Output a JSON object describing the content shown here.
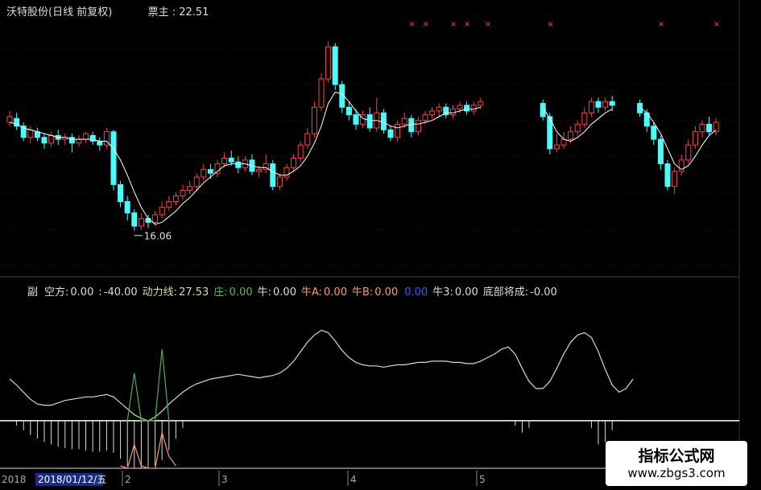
{
  "main_header": {
    "title": "沃特股份(日线 前复权)",
    "indicator_label": "票主",
    "indicator_value": "22.51"
  },
  "sub_header": {
    "items": [
      {
        "label": "副",
        "value": "",
        "color": "#dddddd"
      },
      {
        "label": "空方:",
        "value": "0.00",
        "color": "#dddddd"
      },
      {
        "label": ":",
        "value": "-40.00",
        "color": "#dddddd"
      },
      {
        "label": "动力线:",
        "value": "27.53",
        "color": "#dddd99"
      },
      {
        "label": "庄:",
        "value": "0.00",
        "color": "#55bb55"
      },
      {
        "label": "牛:",
        "value": "0.00",
        "color": "#dddddd"
      },
      {
        "label": "牛A:",
        "value": "0.00",
        "color": "#ff9966"
      },
      {
        "label": "牛B:",
        "value": "0.00",
        "color": "#ff9966"
      },
      {
        "label": "",
        "value": "0.00",
        "color": "#4455ff"
      },
      {
        "label": "牛3:",
        "value": "0.00",
        "color": "#dddddd"
      },
      {
        "label": "底部将成:",
        "value": "-0.00",
        "color": "#dddddd"
      }
    ]
  },
  "annotations": {
    "low_marker": "16.06"
  },
  "date_axis": {
    "label_left": "2018",
    "cursor_date": "2018/01/12/五",
    "ticks": [
      "2",
      "3",
      "4",
      "5"
    ]
  },
  "watermark": {
    "line1": "指标公式网",
    "line2": "www.zbgs3.com"
  },
  "colors": {
    "up": "#ff4040",
    "down": "#44ffff",
    "ma_line": "#ffffff",
    "power_line": "#dddd99",
    "bull_line": "#4caf50",
    "bear_line": "#ff9955",
    "baseline": "#ffffff",
    "marker_x": "#ff4444"
  },
  "chart_data": [
    {
      "type": "candlestick",
      "title": "沃特股份(日线 前复权)",
      "ylim": [
        14,
        27
      ],
      "candles": [
        {
          "i": 0,
          "o": 21.8,
          "c": 22.1,
          "h": 22.4,
          "l": 21.6
        },
        {
          "i": 1,
          "o": 22.0,
          "c": 21.6,
          "h": 22.3,
          "l": 21.4
        },
        {
          "i": 2,
          "o": 21.6,
          "c": 21.0,
          "h": 21.8,
          "l": 20.8
        },
        {
          "i": 3,
          "o": 21.0,
          "c": 21.4,
          "h": 21.6,
          "l": 20.7
        },
        {
          "i": 4,
          "o": 21.3,
          "c": 21.0,
          "h": 21.5,
          "l": 20.8
        },
        {
          "i": 5,
          "o": 21.0,
          "c": 20.7,
          "h": 21.2,
          "l": 20.4
        },
        {
          "i": 6,
          "o": 20.7,
          "c": 21.1,
          "h": 21.3,
          "l": 20.5
        },
        {
          "i": 7,
          "o": 21.1,
          "c": 20.9,
          "h": 21.4,
          "l": 20.6
        },
        {
          "i": 8,
          "o": 20.9,
          "c": 21.0,
          "h": 21.2,
          "l": 20.6
        },
        {
          "i": 9,
          "o": 21.0,
          "c": 20.7,
          "h": 21.2,
          "l": 20.2
        },
        {
          "i": 10,
          "o": 20.7,
          "c": 20.9,
          "h": 21.1,
          "l": 20.5
        },
        {
          "i": 11,
          "o": 20.9,
          "c": 21.2,
          "h": 21.3,
          "l": 20.7
        },
        {
          "i": 12,
          "o": 21.1,
          "c": 20.8,
          "h": 21.3,
          "l": 20.6
        },
        {
          "i": 13,
          "o": 20.8,
          "c": 20.6,
          "h": 21.0,
          "l": 20.3
        },
        {
          "i": 14,
          "o": 20.6,
          "c": 21.3,
          "h": 21.5,
          "l": 20.4
        },
        {
          "i": 15,
          "o": 21.3,
          "c": 18.5,
          "h": 21.4,
          "l": 18.2
        },
        {
          "i": 16,
          "o": 18.5,
          "c": 17.6,
          "h": 18.7,
          "l": 17.3
        },
        {
          "i": 17,
          "o": 17.6,
          "c": 17.0,
          "h": 17.9,
          "l": 16.6
        },
        {
          "i": 18,
          "o": 17.0,
          "c": 16.3,
          "h": 17.2,
          "l": 16.06
        },
        {
          "i": 19,
          "o": 16.3,
          "c": 16.7,
          "h": 17.0,
          "l": 16.1
        },
        {
          "i": 20,
          "o": 16.7,
          "c": 16.5,
          "h": 16.9,
          "l": 16.2
        },
        {
          "i": 21,
          "o": 16.5,
          "c": 16.9,
          "h": 17.1,
          "l": 16.3
        },
        {
          "i": 22,
          "o": 16.9,
          "c": 17.3,
          "h": 17.6,
          "l": 16.7
        },
        {
          "i": 23,
          "o": 17.3,
          "c": 17.6,
          "h": 17.9,
          "l": 17.1
        },
        {
          "i": 24,
          "o": 17.6,
          "c": 17.9,
          "h": 18.1,
          "l": 17.4
        },
        {
          "i": 25,
          "o": 17.9,
          "c": 18.2,
          "h": 18.5,
          "l": 17.7
        },
        {
          "i": 26,
          "o": 18.2,
          "c": 18.4,
          "h": 18.7,
          "l": 18.0
        },
        {
          "i": 27,
          "o": 18.4,
          "c": 18.9,
          "h": 19.1,
          "l": 18.2
        },
        {
          "i": 28,
          "o": 18.9,
          "c": 19.3,
          "h": 19.6,
          "l": 18.7
        },
        {
          "i": 29,
          "o": 19.3,
          "c": 19.1,
          "h": 19.6,
          "l": 18.8
        },
        {
          "i": 30,
          "o": 19.1,
          "c": 19.6,
          "h": 19.8,
          "l": 18.9
        },
        {
          "i": 31,
          "o": 19.6,
          "c": 19.9,
          "h": 20.2,
          "l": 19.4
        },
        {
          "i": 32,
          "o": 19.9,
          "c": 19.7,
          "h": 20.3,
          "l": 19.5
        },
        {
          "i": 33,
          "o": 19.7,
          "c": 19.4,
          "h": 20.0,
          "l": 19.1
        },
        {
          "i": 34,
          "o": 19.4,
          "c": 19.8,
          "h": 20.0,
          "l": 19.2
        },
        {
          "i": 35,
          "o": 19.8,
          "c": 19.2,
          "h": 20.1,
          "l": 19.0
        },
        {
          "i": 36,
          "o": 19.2,
          "c": 19.3,
          "h": 19.5,
          "l": 18.9
        },
        {
          "i": 37,
          "o": 19.3,
          "c": 19.6,
          "h": 20.1,
          "l": 19.1
        },
        {
          "i": 38,
          "o": 19.6,
          "c": 18.4,
          "h": 19.8,
          "l": 18.2
        },
        {
          "i": 39,
          "o": 18.4,
          "c": 18.9,
          "h": 19.1,
          "l": 18.2
        },
        {
          "i": 40,
          "o": 18.9,
          "c": 19.4,
          "h": 19.6,
          "l": 18.7
        },
        {
          "i": 41,
          "o": 19.4,
          "c": 19.9,
          "h": 20.1,
          "l": 19.2
        },
        {
          "i": 42,
          "o": 19.9,
          "c": 20.6,
          "h": 20.8,
          "l": 19.7
        },
        {
          "i": 43,
          "o": 20.6,
          "c": 21.2,
          "h": 21.5,
          "l": 20.4
        },
        {
          "i": 44,
          "o": 21.2,
          "c": 22.6,
          "h": 22.9,
          "l": 21.0
        },
        {
          "i": 45,
          "o": 22.6,
          "c": 24.1,
          "h": 24.4,
          "l": 22.4
        },
        {
          "i": 46,
          "o": 24.1,
          "c": 25.8,
          "h": 26.1,
          "l": 23.9
        },
        {
          "i": 47,
          "o": 25.8,
          "c": 23.8,
          "h": 26.0,
          "l": 23.5
        },
        {
          "i": 48,
          "o": 23.8,
          "c": 22.6,
          "h": 24.0,
          "l": 22.3
        },
        {
          "i": 49,
          "o": 22.6,
          "c": 22.2,
          "h": 22.9,
          "l": 21.9
        },
        {
          "i": 50,
          "o": 22.2,
          "c": 21.7,
          "h": 22.5,
          "l": 21.4
        },
        {
          "i": 51,
          "o": 21.7,
          "c": 22.2,
          "h": 22.4,
          "l": 21.5
        },
        {
          "i": 52,
          "o": 22.2,
          "c": 21.5,
          "h": 22.6,
          "l": 21.3
        },
        {
          "i": 53,
          "o": 21.5,
          "c": 22.3,
          "h": 23.1,
          "l": 21.3
        },
        {
          "i": 54,
          "o": 22.3,
          "c": 21.4,
          "h": 22.5,
          "l": 21.2
        },
        {
          "i": 55,
          "o": 21.4,
          "c": 21.0,
          "h": 21.6,
          "l": 20.8
        },
        {
          "i": 56,
          "o": 21.0,
          "c": 21.7,
          "h": 21.9,
          "l": 20.8
        },
        {
          "i": 57,
          "o": 21.7,
          "c": 22.0,
          "h": 22.3,
          "l": 21.5
        },
        {
          "i": 58,
          "o": 22.0,
          "c": 21.3,
          "h": 22.2,
          "l": 21.0
        },
        {
          "i": 59,
          "o": 21.3,
          "c": 21.9,
          "h": 22.1,
          "l": 21.1
        },
        {
          "i": 60,
          "o": 21.9,
          "c": 22.2,
          "h": 22.4,
          "l": 21.7
        },
        {
          "i": 61,
          "o": 22.2,
          "c": 22.4,
          "h": 22.6,
          "l": 22.0
        },
        {
          "i": 62,
          "o": 22.4,
          "c": 22.6,
          "h": 22.8,
          "l": 22.1
        },
        {
          "i": 63,
          "o": 22.6,
          "c": 22.2,
          "h": 22.8,
          "l": 22.0
        },
        {
          "i": 64,
          "o": 22.2,
          "c": 22.5,
          "h": 22.7,
          "l": 22.0
        },
        {
          "i": 65,
          "o": 22.5,
          "c": 22.7,
          "h": 22.9,
          "l": 22.3
        },
        {
          "i": 66,
          "o": 22.7,
          "c": 22.4,
          "h": 22.9,
          "l": 22.2
        },
        {
          "i": 67,
          "o": 22.4,
          "c": 22.7,
          "h": 22.9,
          "l": 22.2
        },
        {
          "i": 68,
          "o": 22.7,
          "c": 22.9,
          "h": 23.1,
          "l": 22.5
        },
        {
          "i": 77,
          "o": 22.8,
          "c": 22.1,
          "h": 23.0,
          "l": 21.9
        },
        {
          "i": 78,
          "o": 22.1,
          "c": 20.4,
          "h": 22.3,
          "l": 20.1
        },
        {
          "i": 79,
          "o": 20.4,
          "c": 20.6,
          "h": 21.2,
          "l": 20.2
        },
        {
          "i": 80,
          "o": 20.6,
          "c": 20.9,
          "h": 21.3,
          "l": 20.4
        },
        {
          "i": 81,
          "o": 20.9,
          "c": 21.3,
          "h": 21.6,
          "l": 20.7
        },
        {
          "i": 82,
          "o": 21.3,
          "c": 21.7,
          "h": 21.9,
          "l": 21.1
        },
        {
          "i": 83,
          "o": 21.7,
          "c": 22.3,
          "h": 22.6,
          "l": 21.5
        },
        {
          "i": 84,
          "o": 22.3,
          "c": 22.9,
          "h": 23.1,
          "l": 22.1
        },
        {
          "i": 85,
          "o": 22.9,
          "c": 22.6,
          "h": 23.1,
          "l": 22.3
        },
        {
          "i": 86,
          "o": 22.6,
          "c": 22.9,
          "h": 23.1,
          "l": 22.4
        },
        {
          "i": 87,
          "o": 22.9,
          "c": 22.7,
          "h": 23.2,
          "l": 22.4
        },
        {
          "i": 91,
          "o": 22.8,
          "c": 22.3,
          "h": 23.0,
          "l": 22.1
        },
        {
          "i": 92,
          "o": 22.3,
          "c": 21.6,
          "h": 22.5,
          "l": 21.3
        },
        {
          "i": 93,
          "o": 21.6,
          "c": 20.9,
          "h": 21.8,
          "l": 20.6
        },
        {
          "i": 94,
          "o": 20.9,
          "c": 19.6,
          "h": 21.1,
          "l": 19.3
        },
        {
          "i": 95,
          "o": 19.6,
          "c": 18.4,
          "h": 19.8,
          "l": 18.2
        },
        {
          "i": 96,
          "o": 18.4,
          "c": 19.2,
          "h": 19.4,
          "l": 18.0
        },
        {
          "i": 97,
          "o": 19.2,
          "c": 19.8,
          "h": 20.1,
          "l": 19.0
        },
        {
          "i": 98,
          "o": 19.8,
          "c": 20.6,
          "h": 20.9,
          "l": 19.6
        },
        {
          "i": 99,
          "o": 20.6,
          "c": 21.3,
          "h": 21.6,
          "l": 20.4
        },
        {
          "i": 100,
          "o": 21.3,
          "c": 21.7,
          "h": 21.9,
          "l": 21.0
        },
        {
          "i": 101,
          "o": 21.7,
          "c": 21.3,
          "h": 22.1,
          "l": 21.1
        },
        {
          "i": 102,
          "o": 21.3,
          "c": 21.8,
          "h": 22.0,
          "l": 21.1
        }
      ],
      "ma": [
        21.8,
        21.7,
        21.5,
        21.4,
        21.3,
        21.2,
        21.1,
        21.0,
        21.0,
        20.9,
        20.9,
        20.9,
        20.9,
        20.8,
        20.8,
        20.4,
        19.8,
        19.0,
        18.1,
        17.3,
        16.7,
        16.4,
        16.5,
        16.8,
        17.1,
        17.5,
        17.8,
        18.2,
        18.6,
        18.9,
        19.2,
        19.5,
        19.6,
        19.6,
        19.6,
        19.5,
        19.4,
        19.4,
        19.2,
        19.0,
        19.0,
        19.2,
        19.5,
        20.0,
        20.7,
        21.6,
        22.8,
        23.4,
        23.3,
        22.9,
        22.4,
        22.0,
        21.9,
        21.9,
        21.8,
        21.6,
        21.5,
        21.6,
        21.7,
        21.7,
        21.8,
        21.9,
        22.1,
        22.3,
        22.3,
        22.4,
        22.5,
        22.5,
        22.6,
        null,
        null,
        null,
        null,
        null,
        null,
        null,
        null,
        22.6,
        22.0,
        21.3,
        20.9,
        20.8,
        21.0,
        21.3,
        21.7,
        22.0,
        22.3,
        22.5,
        null,
        null,
        null,
        22.6,
        22.3,
        21.8,
        21.2,
        20.4,
        19.6,
        19.3,
        19.5,
        20.0,
        20.6,
        21.1,
        21.4
      ],
      "low_label": {
        "i": 18,
        "value": 16.06
      },
      "markers_top": [
        57,
        59,
        63,
        65,
        68,
        77,
        93,
        101,
        108
      ]
    },
    {
      "type": "line",
      "title": "副",
      "ylim": [
        -40,
        100
      ],
      "series": [
        {
          "name": "动力线",
          "values": [
            35,
            30,
            24,
            18,
            14,
            13,
            13,
            15,
            17,
            18,
            19,
            20,
            20,
            21,
            22,
            20,
            15,
            10,
            5,
            2,
            0,
            3,
            8,
            14,
            19,
            24,
            28,
            31,
            33,
            35,
            36,
            37,
            38,
            39,
            38,
            37,
            36,
            37,
            38,
            40,
            44,
            50,
            58,
            66,
            72,
            76,
            74,
            67,
            59,
            53,
            49,
            47,
            46,
            46,
            45,
            46,
            47,
            47,
            48,
            49,
            49,
            50,
            50,
            50,
            49,
            49,
            48,
            48,
            50,
            53,
            56,
            60,
            62,
            56,
            44,
            33,
            27,
            27,
            33,
            44,
            56,
            66,
            72,
            74,
            70,
            58,
            43,
            30,
            24,
            27,
            35
          ]
        },
        {
          "name": "空方",
          "values": [
            0,
            -4,
            -8,
            -12,
            -15,
            -18,
            -20,
            -22,
            -23,
            -24,
            -24,
            -25,
            -26,
            -26,
            -25,
            -27,
            -32,
            -38,
            -40,
            -40,
            -40,
            -38,
            -33,
            -25,
            -15,
            -6,
            0,
            0,
            0,
            0,
            0,
            0,
            0,
            0,
            0,
            0,
            0,
            0,
            0,
            0,
            0,
            0,
            0,
            0,
            0,
            0,
            0,
            0,
            0,
            0,
            0,
            0,
            0,
            0,
            0,
            0,
            0,
            0,
            0,
            0,
            0,
            0,
            0,
            0,
            0,
            0,
            0,
            0,
            0,
            0,
            0,
            0,
            0,
            -4,
            -10,
            -6,
            0,
            0,
            0,
            0,
            0,
            0,
            0,
            0,
            -6,
            -20,
            -18,
            -8,
            0,
            0,
            0
          ]
        },
        {
          "name": "庄",
          "values": [
            {
              "i": 17,
              "v": 0
            },
            {
              "i": 18,
              "v": 40
            },
            {
              "i": 19,
              "v": 0
            },
            {
              "i": 20,
              "v": 0
            },
            {
              "i": 21,
              "v": 0
            },
            {
              "i": 22,
              "v": 60
            },
            {
              "i": 23,
              "v": 0
            }
          ]
        },
        {
          "name": "牛",
          "values": [
            {
              "i": 16,
              "v": -38
            },
            {
              "i": 17,
              "v": -40
            },
            {
              "i": 18,
              "v": -20
            },
            {
              "i": 19,
              "v": -38
            },
            {
              "i": 20,
              "v": -40
            },
            {
              "i": 21,
              "v": -40
            },
            {
              "i": 22,
              "v": -10
            },
            {
              "i": 23,
              "v": -30
            },
            {
              "i": 24,
              "v": -38
            }
          ]
        }
      ],
      "baseline": 0
    }
  ]
}
